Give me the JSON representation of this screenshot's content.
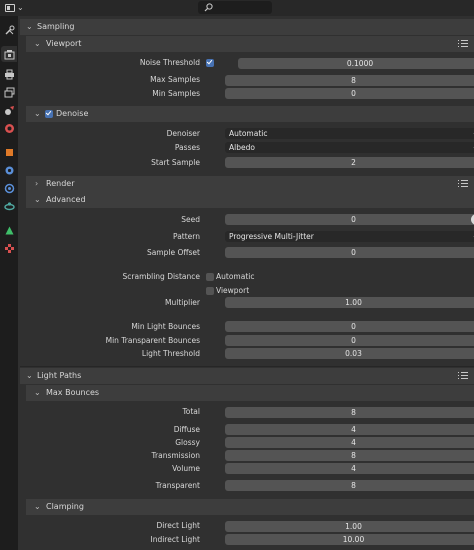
{
  "top_bar": {
    "editor_type_icon": "properties-editor-icon",
    "search_icon": "search-icon",
    "search_placeholder": ""
  },
  "tabs": [
    {
      "name": "tool-tab",
      "icon": "wrench-screwdriver-icon",
      "color": "#c8c8c8"
    },
    {
      "name": "render-tab",
      "icon": "camera-back-icon",
      "color": "#c8c8c8",
      "active": true
    },
    {
      "name": "output-tab",
      "icon": "printer-icon",
      "color": "#c8c8c8"
    },
    {
      "name": "view-layer-tab",
      "icon": "image-stack-icon",
      "color": "#c8c8c8"
    },
    {
      "name": "scene-tab",
      "icon": "scene-cone-icon",
      "color": "#c8c8c8"
    },
    {
      "name": "world-tab",
      "icon": "globe-icon",
      "color": "#d85050"
    },
    {
      "name": "object-tab",
      "icon": "orange-square-icon",
      "color": "#e07a28"
    },
    {
      "name": "modifier-tab",
      "icon": "wrench-blue-icon",
      "color": "#5a8fd8"
    },
    {
      "name": "particles-tab",
      "icon": "particles-icon",
      "color": "#5a8fd8"
    },
    {
      "name": "physics-tab",
      "icon": "physics-orbit-icon",
      "color": "#4fa8a0"
    },
    {
      "name": "object-data-tab",
      "icon": "green-triangle-icon",
      "color": "#3fbf6a"
    },
    {
      "name": "texture-tab",
      "icon": "checkerboard-icon",
      "color": "#d85050"
    }
  ],
  "sampling": {
    "title": "Sampling",
    "viewport": {
      "title": "Viewport",
      "noise_threshold_label": "Noise Threshold",
      "noise_threshold_checked": true,
      "noise_threshold_value": "0.1000",
      "max_samples_label": "Max Samples",
      "max_samples_value": "8",
      "min_samples_label": "Min Samples",
      "min_samples_value": "0"
    },
    "denoise": {
      "title": "Denoise",
      "checked": true,
      "denoiser_label": "Denoiser",
      "denoiser_value": "Automatic",
      "passes_label": "Passes",
      "passes_value": "Albedo",
      "start_sample_label": "Start Sample",
      "start_sample_value": "2"
    },
    "render": {
      "title": "Render"
    },
    "advanced": {
      "title": "Advanced",
      "seed_label": "Seed",
      "seed_value": "0",
      "pattern_label": "Pattern",
      "pattern_value": "Progressive Multi-Jitter",
      "sample_offset_label": "Sample Offset",
      "sample_offset_value": "0",
      "scrambling_label": "Scrambling Distance",
      "automatic_label": "Automatic",
      "automatic_checked": false,
      "viewport_label": "Viewport",
      "viewport_checked": false,
      "multiplier_label": "Multiplier",
      "multiplier_value": "1.00",
      "min_light_bounces_label": "Min Light Bounces",
      "min_light_bounces_value": "0",
      "min_transparent_bounces_label": "Min Transparent Bounces",
      "min_transparent_bounces_value": "0",
      "light_threshold_label": "Light Threshold",
      "light_threshold_value": "0.03"
    }
  },
  "light_paths": {
    "title": "Light Paths",
    "max_bounces": {
      "title": "Max Bounces",
      "total_label": "Total",
      "total_value": "8",
      "diffuse_label": "Diffuse",
      "diffuse_value": "4",
      "glossy_label": "Glossy",
      "glossy_value": "4",
      "transmission_label": "Transmission",
      "transmission_value": "8",
      "volume_label": "Volume",
      "volume_value": "4",
      "transparent_label": "Transparent",
      "transparent_value": "8"
    },
    "clamping": {
      "title": "Clamping",
      "direct_light_label": "Direct Light",
      "direct_light_value": "1.00",
      "indirect_light_label": "Indirect Light",
      "indirect_light_value": "10.00"
    }
  },
  "colors": {
    "accent": "#4772b3",
    "panel_bg": "#303030",
    "header_bg": "#3d3d3d",
    "field_bg": "#545454",
    "dropdown_bg": "#282828",
    "tab_bar_bg": "#1d1d1d"
  }
}
